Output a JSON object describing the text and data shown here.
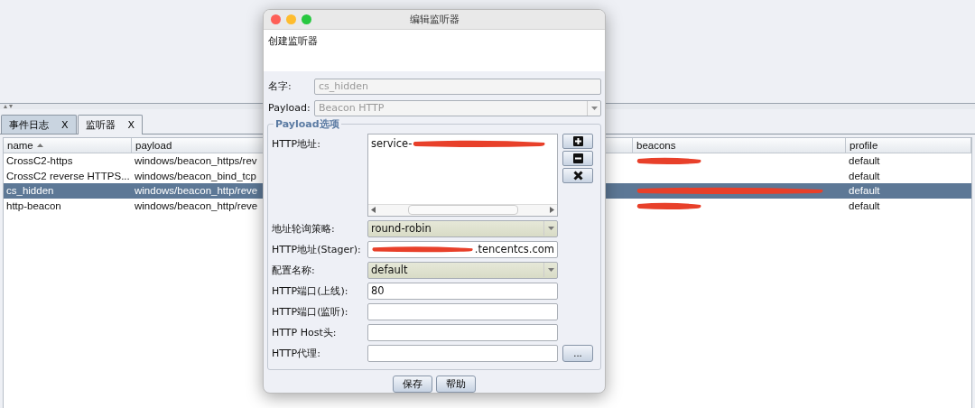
{
  "tabs": [
    {
      "label": "事件日志",
      "close": "X",
      "selected": false
    },
    {
      "label": "监听器",
      "close": "X",
      "selected": true
    }
  ],
  "table": {
    "columns": [
      {
        "label": "name",
        "sorted": true
      },
      {
        "label": "payload",
        "sorted": false
      },
      {
        "label": "beacons",
        "sorted": false
      },
      {
        "label": "profile",
        "sorted": false
      }
    ],
    "rows": [
      {
        "name": "CrossC2-https",
        "payload": "windows/beacon_https/rev",
        "beacons_redacted": true,
        "profile": "default",
        "selected": false
      },
      {
        "name": "CrossC2 reverse HTTPS...",
        "payload": "windows/beacon_bind_tcp",
        "beacons_redacted": false,
        "profile": "default",
        "selected": false
      },
      {
        "name": "cs_hidden",
        "payload": "windows/beacon_http/reve",
        "beacons_redacted": true,
        "profile": "default",
        "selected": true
      },
      {
        "name": "http-beacon",
        "payload": "windows/beacon_http/reve",
        "beacons_redacted": true,
        "profile": "default",
        "selected": false
      }
    ]
  },
  "dialog": {
    "title": "编辑监听器",
    "description": "创建监听器",
    "top_fields": [
      {
        "label": "名字:",
        "kind": "text",
        "value": "cs_hidden",
        "disabled": true
      },
      {
        "label": "Payload:",
        "kind": "combo",
        "value": "Beacon HTTP",
        "disabled": true
      }
    ],
    "group_title": "Payload选项",
    "fields": [
      {
        "label": "HTTP地址:",
        "kind": "list",
        "value": "service-",
        "redacted": true
      },
      {
        "label": "地址轮询策略:",
        "kind": "combo",
        "value": "round-robin",
        "redacted": false
      },
      {
        "label": "HTTP地址(Stager):",
        "kind": "text",
        "value": ".tencentcs.com",
        "redacted": true
      },
      {
        "label": "配置名称:",
        "kind": "combo",
        "value": "default",
        "redacted": false
      },
      {
        "label": "HTTP端口(上线):",
        "kind": "text",
        "value": "80",
        "redacted": false
      },
      {
        "label": "HTTP端口(监听):",
        "kind": "text",
        "redacted": false
      },
      {
        "label": "HTTP Host头:",
        "kind": "text",
        "redacted": false
      },
      {
        "label": "HTTP代理:",
        "kind": "browse",
        "browse_label": "...",
        "redacted": false
      }
    ],
    "buttons": [
      "保存",
      "帮助"
    ]
  }
}
